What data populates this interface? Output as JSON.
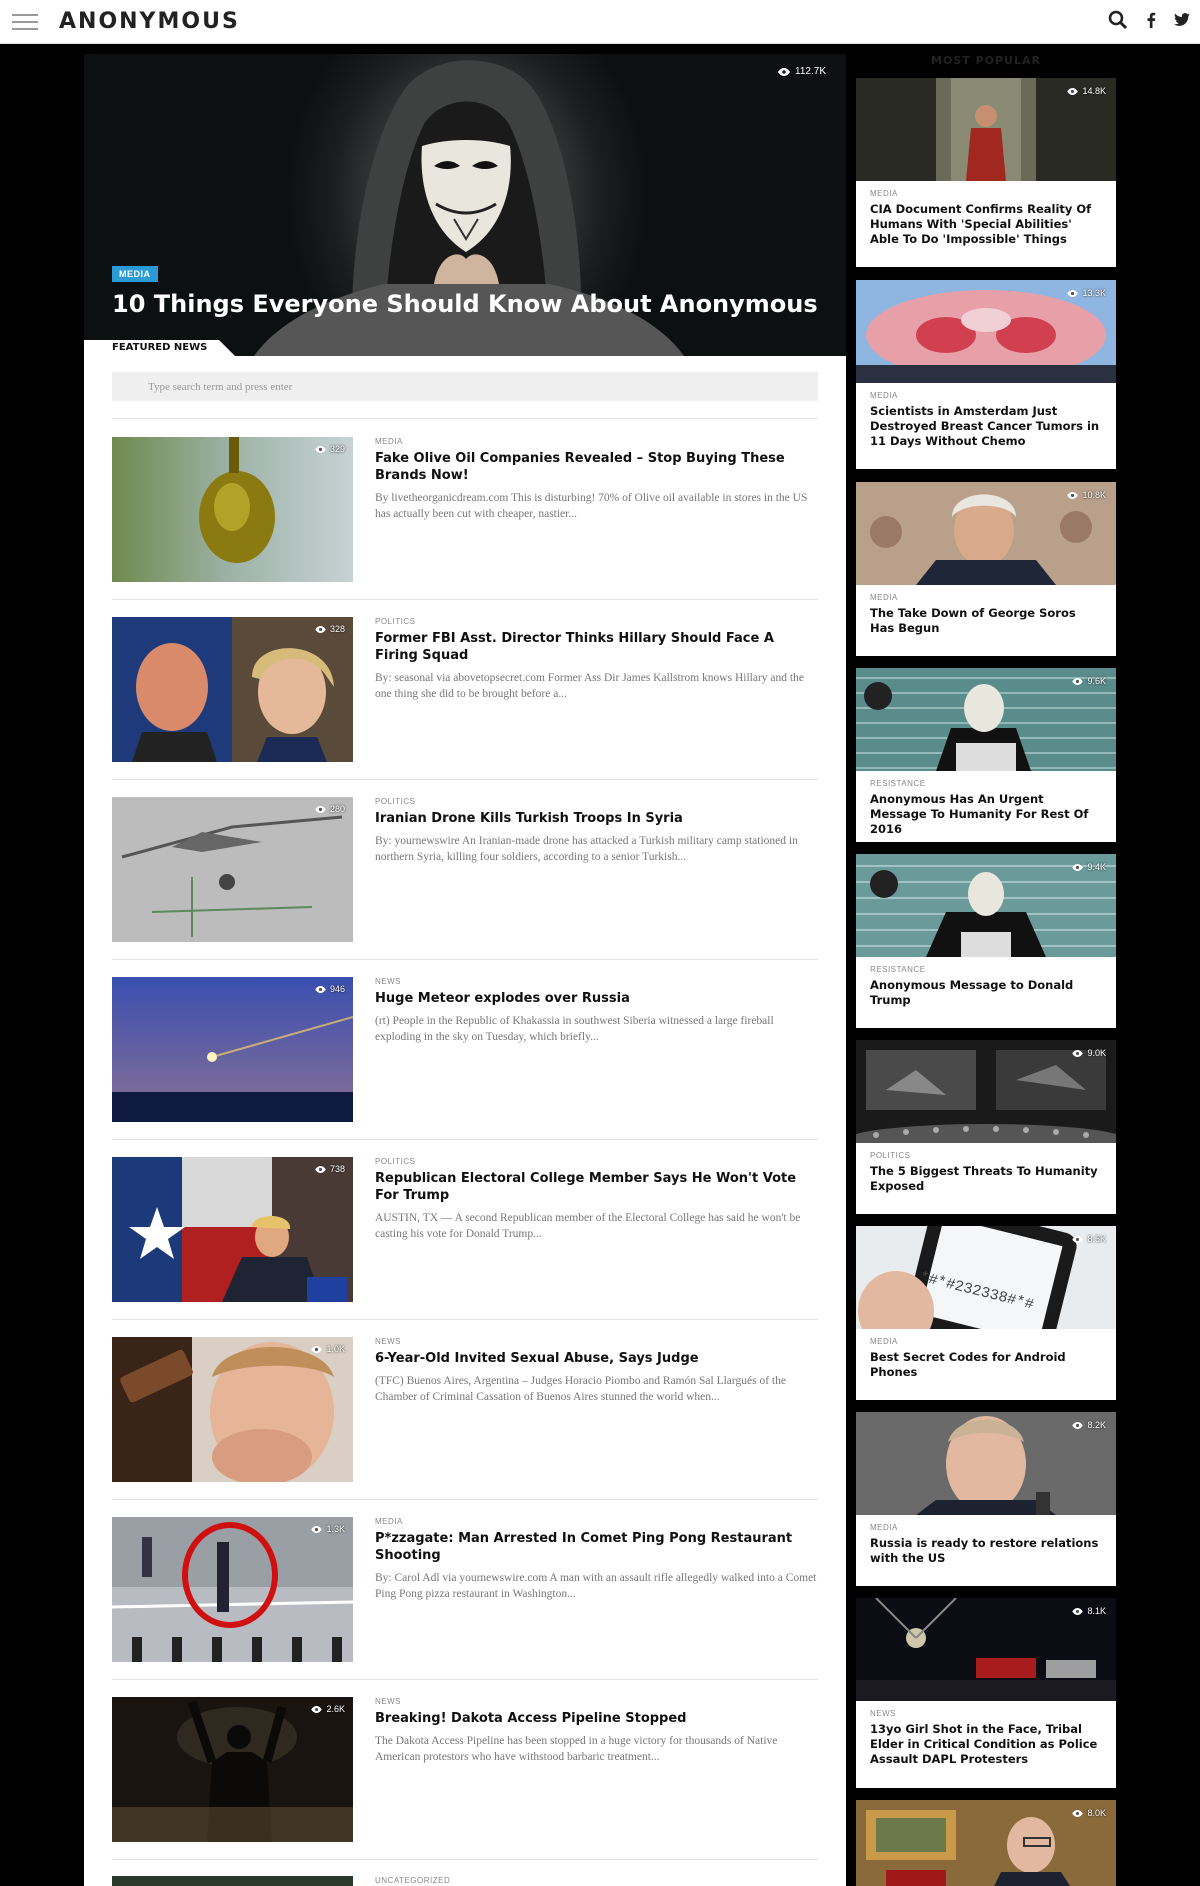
{
  "site": {
    "logo": "ANONYMOUS"
  },
  "hero": {
    "views": "112.7K",
    "category": "MEDIA",
    "title": "10 Things Everyone Should Know About Anonymous"
  },
  "featured_tab": "FEATURED NEWS",
  "search": {
    "placeholder": "Type search term and press enter"
  },
  "articles": [
    {
      "category": "MEDIA",
      "views": "329",
      "title": "Fake Olive Oil Companies Revealed – Stop Buying These Brands Now!",
      "excerpt": "By livetheorganicdream.com This is disturbing! 70% of Olive oil available in stores in the US has actually been cut with cheaper, nastier..."
    },
    {
      "category": "POLITICS",
      "views": "328",
      "title": "Former FBI Asst. Director Thinks Hillary Should Face A Firing Squad",
      "excerpt": "By: seasonal via abovetopsecret.com Former Ass Dir James Kallstrom knows Hillary and the one thing she did to be brought before a..."
    },
    {
      "category": "POLITICS",
      "views": "280",
      "title": "Iranian Drone Kills Turkish Troops In Syria",
      "excerpt": "By: yournewswire An Iranian-made drone has attacked a Turkish military camp stationed in northern Syria, killing four soldiers, according to a senior Turkish..."
    },
    {
      "category": "NEWS",
      "views": "946",
      "title": "Huge Meteor explodes over Russia",
      "excerpt": "(rt) People in the Republic of Khakassia in southwest Siberia witnessed a large fireball exploding in the sky on Tuesday, which briefly..."
    },
    {
      "category": "POLITICS",
      "views": "738",
      "title": "Republican Electoral College Member Says He Won't Vote For Trump",
      "excerpt": "AUSTIN, TX — A second Republican member of the Electoral College has said he won't be casting his vote for Donald Trump..."
    },
    {
      "category": "NEWS",
      "views": "1.0K",
      "title": "6-Year-Old Invited Sexual Abuse, Says Judge",
      "excerpt": "(TFC) Buenos Aires, Argentina – Judges Horacio Piombo and Ramón Sal Llargués of the Chamber of Criminal Cassation of Buenos Aires stunned the world when..."
    },
    {
      "category": "MEDIA",
      "views": "1.3K",
      "title": "P*zzagate: Man Arrested In Comet Ping Pong Restaurant Shooting",
      "excerpt": "By: Carol Adl via yournewswire.com A man with an assault rifle allegedly walked into a Comet Ping Pong pizza restaurant in Washington..."
    },
    {
      "category": "NEWS",
      "views": "2.6K",
      "title": "Breaking! Dakota Access Pipeline Stopped",
      "excerpt": "The Dakota Access Pipeline has been stopped in a huge victory for thousands of Native American protestors who have withstood barbaric treatment..."
    },
    {
      "category": "UNCATEGORIZED",
      "views": "",
      "title": "",
      "excerpt": ""
    }
  ],
  "sidebar": {
    "title": "MOST POPULAR",
    "items": [
      {
        "category": "MEDIA",
        "views": "14.8K",
        "title": "CIA Document Confirms Reality Of Humans With 'Special Abilities' Able To Do 'Impossible' Things"
      },
      {
        "category": "MEDIA",
        "views": "13.3K",
        "title": "Scientists in Amsterdam Just Destroyed Breast Cancer Tumors in 11 Days Without Chemo"
      },
      {
        "category": "MEDIA",
        "views": "10.8K",
        "title": "The Take Down of George Soros Has Begun"
      },
      {
        "category": "RESISTANCE",
        "views": "9.6K",
        "title": "Anonymous Has An Urgent Message To Humanity For Rest Of 2016"
      },
      {
        "category": "RESISTANCE",
        "views": "9.4K",
        "title": "Anonymous Message to Donald Trump"
      },
      {
        "category": "POLITICS",
        "views": "9.0K",
        "title": "The 5 Biggest Threats To Humanity Exposed"
      },
      {
        "category": "MEDIA",
        "views": "8.5K",
        "title": "Best Secret Codes for Android Phones"
      },
      {
        "category": "MEDIA",
        "views": "8.2K",
        "title": "Russia is ready to restore relations with the US"
      },
      {
        "category": "NEWS",
        "views": "8.1K",
        "title": "13yo Girl Shot in the Face, Tribal Elder in Critical Condition as Police Assault DAPL Protesters"
      },
      {
        "category": "",
        "views": "8.0K",
        "title": ""
      }
    ]
  },
  "image_text": {
    "phone_code": "*#*#232338#*#"
  },
  "colors": {
    "accent": "#2b9bd7",
    "page_bg": "#000000",
    "card_bg": "#ffffff"
  },
  "icons": [
    "hamburger-menu-icon",
    "search-icon",
    "facebook-icon",
    "twitter-icon",
    "eye-icon"
  ]
}
